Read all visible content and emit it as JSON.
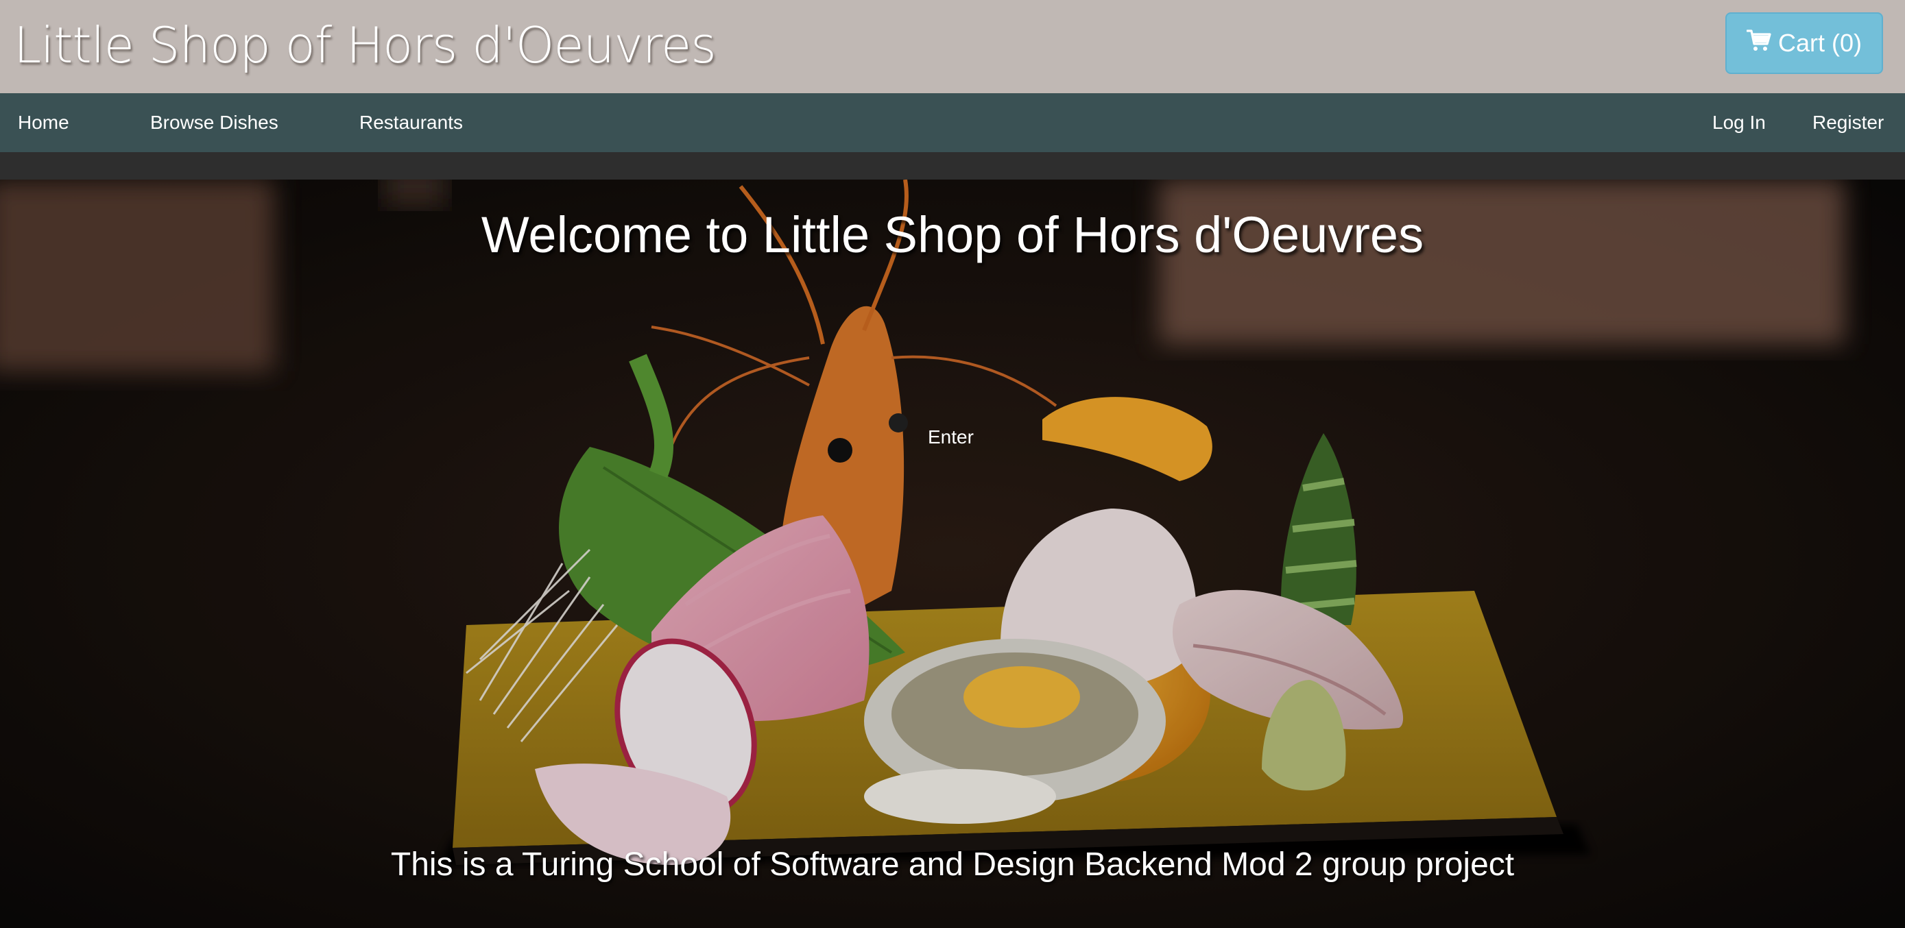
{
  "header": {
    "brand": "Little Shop of Hors d'Oeuvres",
    "cart_label": "Cart (0)",
    "cart_icon": "shopping-cart-icon"
  },
  "nav": {
    "left": [
      "Home",
      "Browse Dishes",
      "Restaurants"
    ],
    "right": [
      "Log In",
      "Register"
    ]
  },
  "hero": {
    "title": "Welcome to Little Shop of Hors d'Oeuvres",
    "enter_label": "Enter",
    "subtitle": "This is a Turing School of Software and Design Backend Mod 2 group project"
  },
  "colors": {
    "topbar": "#c0b8b4",
    "navbar": "#3a5154",
    "cart_button": "#73bfd9"
  }
}
